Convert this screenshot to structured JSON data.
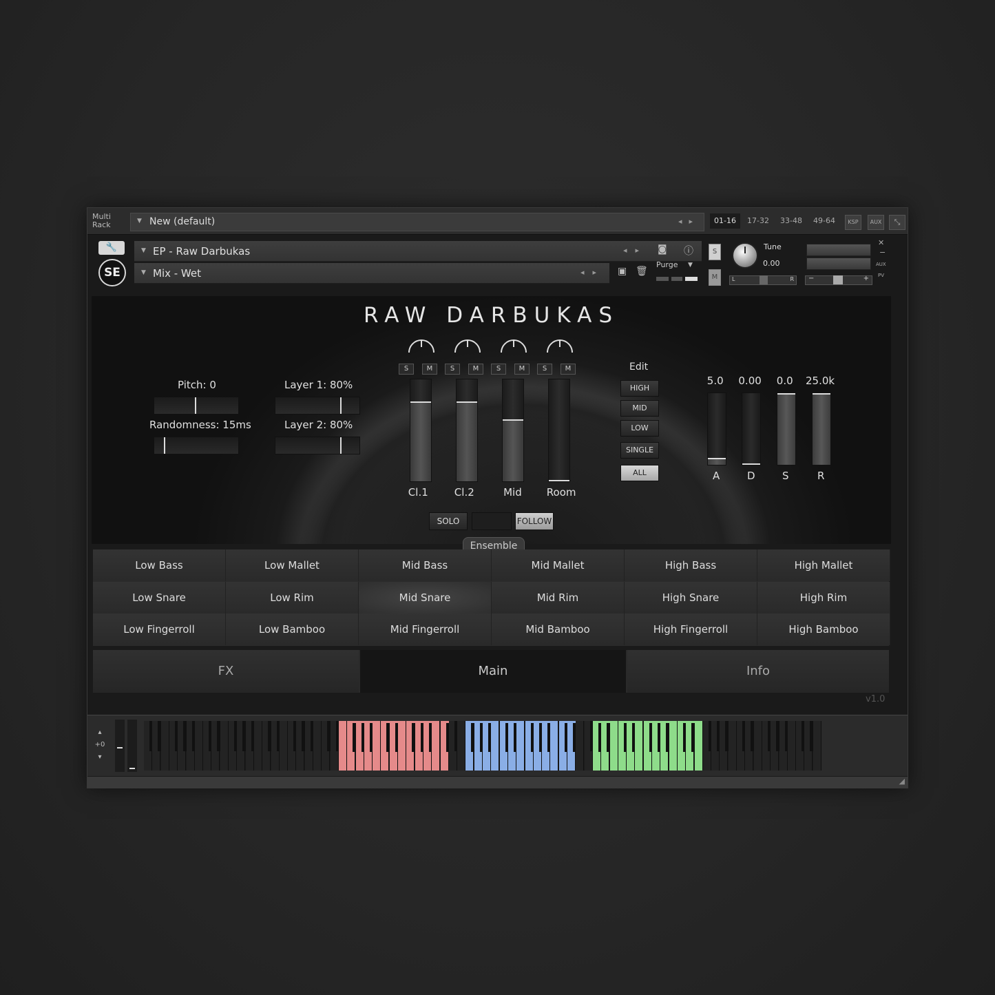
{
  "rack": {
    "label_line1": "Multi",
    "label_line2": "Rack",
    "preset_name": "New (default)",
    "pages": [
      "01-16",
      "17-32",
      "33-48",
      "49-64"
    ],
    "active_page": "01-16",
    "ksp_label": "KSP",
    "aux_label": "AUX"
  },
  "instrument": {
    "name": "EP - Raw Darbukas",
    "snapshot": "Mix - Wet",
    "purge_label": "Purge",
    "s_label": "S",
    "m_label": "M",
    "tune_label": "Tune",
    "tune_value": "0.00",
    "pan_left": "L",
    "pan_right": "R",
    "aux_small": "AUX",
    "pv_small": "PV",
    "vol_minus": "−",
    "vol_plus": "+"
  },
  "main": {
    "title": "RAW DARBUKAS",
    "pitch_label": "Pitch: 0",
    "randomness_label": "Randomness: 15ms",
    "layer1_label": "Layer 1: 80%",
    "layer2_label": "Layer 2: 80%",
    "slider_levels": {
      "pitch": 0.5,
      "randomness": 0.12,
      "layer1": 0.8,
      "layer2": 0.8
    },
    "mixer": [
      {
        "name": "Cl.1",
        "s": "S",
        "m": "M",
        "level": 0.78
      },
      {
        "name": "Cl.2",
        "s": "S",
        "m": "M",
        "level": 0.78
      },
      {
        "name": "Mid",
        "s": "S",
        "m": "M",
        "level": 0.6
      },
      {
        "name": "Room",
        "s": "S",
        "m": "M",
        "level": 0.0
      }
    ],
    "edit_label": "Edit",
    "edit_buttons": [
      "HIGH",
      "MID",
      "LOW",
      "SINGLE",
      "ALL"
    ],
    "edit_active": "ALL",
    "adsr": [
      {
        "name": "A",
        "value": "5.0",
        "level": 0.08
      },
      {
        "name": "D",
        "value": "0.00",
        "level": 0.0
      },
      {
        "name": "S",
        "value": "0.0",
        "level": 1.0
      },
      {
        "name": "R",
        "value": "25.0k",
        "level": 1.0
      }
    ],
    "solo_label": "SOLO",
    "follow_label": "FOLLOW"
  },
  "ensemble": {
    "label": "Ensemble",
    "cells": [
      [
        "Low Bass",
        "Low Mallet",
        "Mid Bass",
        "Mid Mallet",
        "High Bass",
        "High Mallet"
      ],
      [
        "Low Snare",
        "Low Rim",
        "Mid Snare",
        "Mid Rim",
        "High Snare",
        "High Rim"
      ],
      [
        "Low Fingerroll",
        "Low Bamboo",
        "Mid Fingerroll",
        "Mid Bamboo",
        "High Fingerroll",
        "High Bamboo"
      ]
    ],
    "highlighted": "Mid Snare"
  },
  "tabs": [
    "FX",
    "Main",
    "Info"
  ],
  "active_tab": "Main",
  "version": "v1.0",
  "keyboard": {
    "octave_label": "+0",
    "zone_colors": {
      "red": "#e58a8a",
      "blue": "#8aaee6",
      "green": "#8edc8a"
    }
  }
}
